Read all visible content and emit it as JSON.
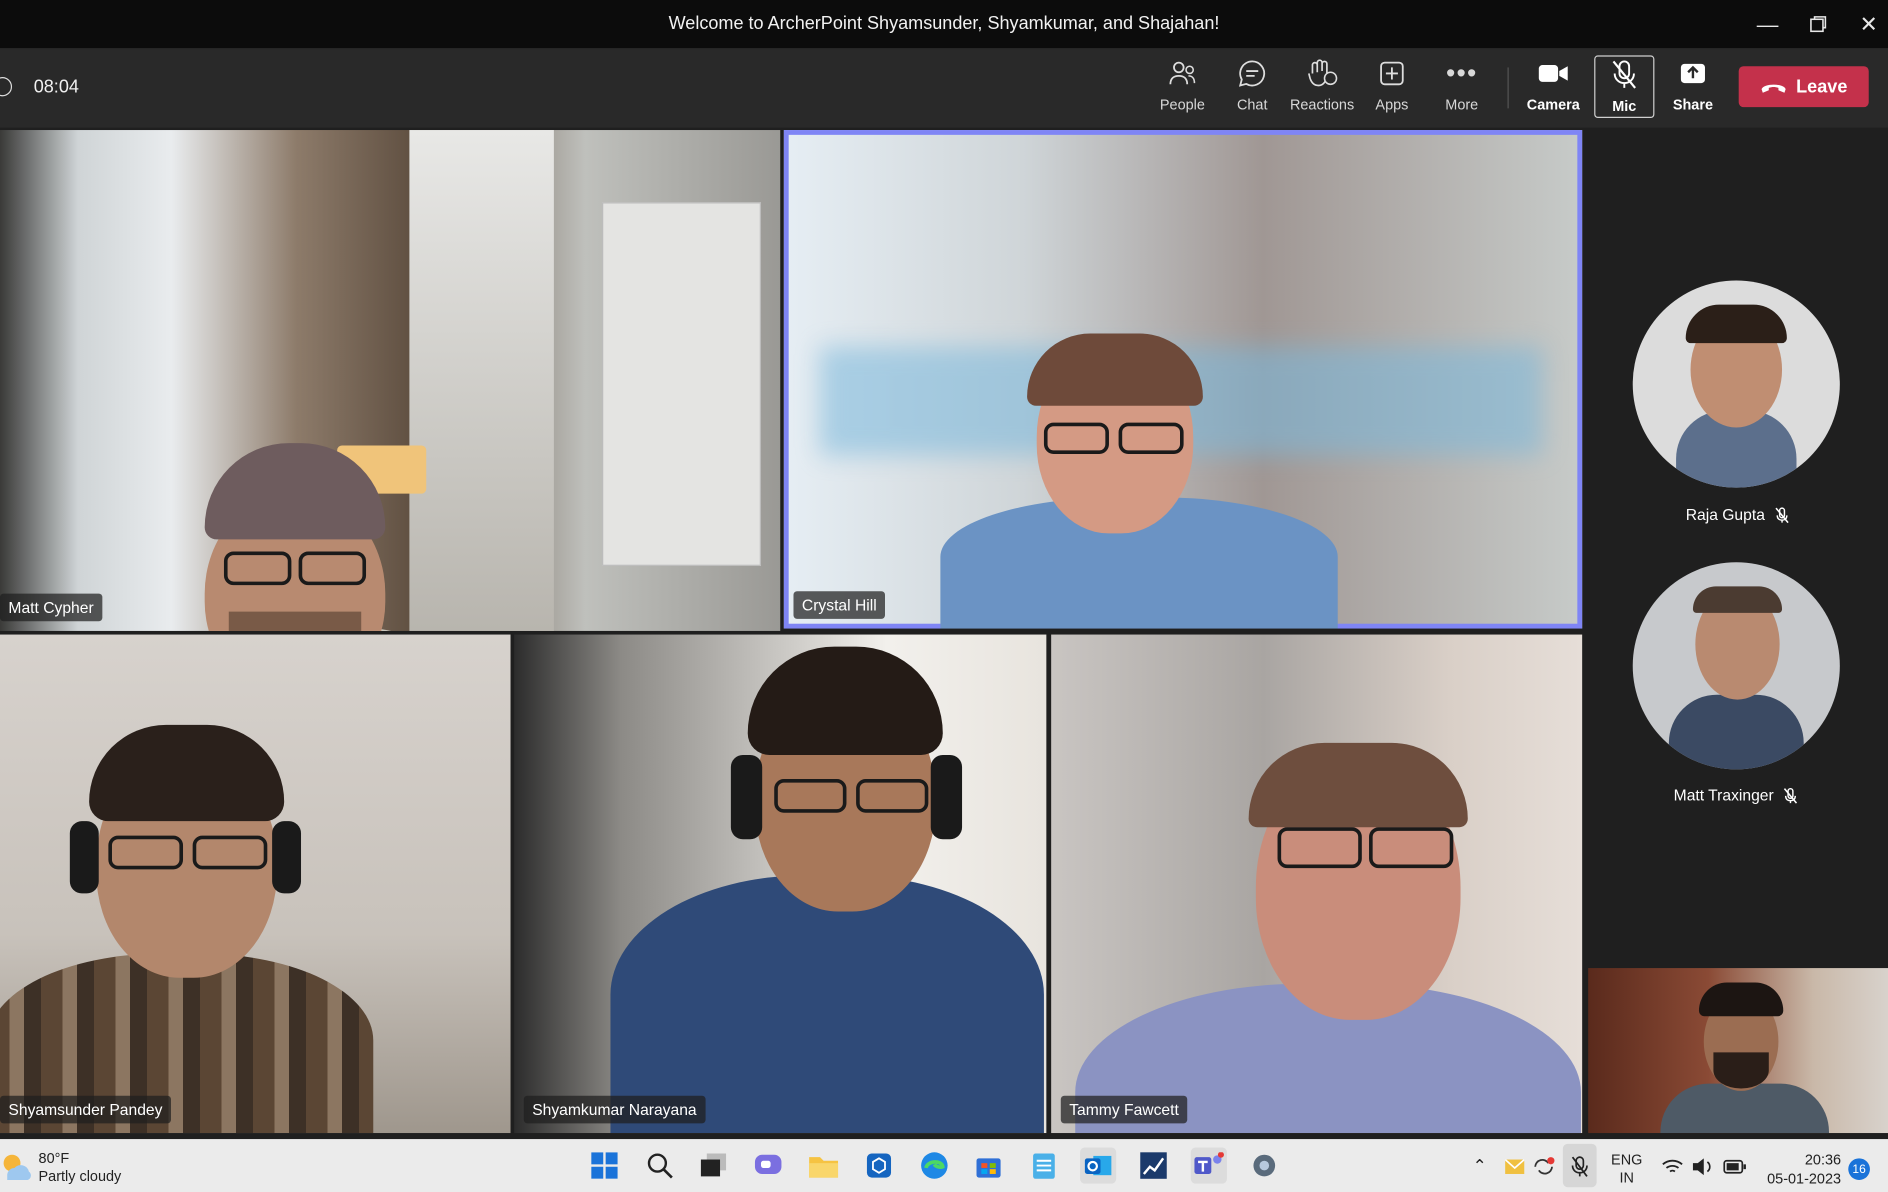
{
  "window": {
    "title": "Welcome to ArcherPoint Shyamsunder, Shyamkumar, and Shajahan!"
  },
  "toolbar": {
    "timer": "08:04",
    "buttons": [
      {
        "label": "People",
        "icon": "people-icon"
      },
      {
        "label": "Chat",
        "icon": "chat-icon"
      },
      {
        "label": "Reactions",
        "icon": "reactions-icon"
      },
      {
        "label": "Apps",
        "icon": "apps-icon"
      },
      {
        "label": "More",
        "icon": "more-icon"
      },
      {
        "label": "Camera",
        "icon": "camera-icon"
      },
      {
        "label": "Mic",
        "icon": "mic-muted-icon"
      },
      {
        "label": "Share",
        "icon": "share-icon"
      }
    ],
    "leave_label": "Leave"
  },
  "participants": {
    "matt_cypher": "Matt Cypher",
    "crystal_hill": "Crystal Hill",
    "shyamsunder": "Shyamsunder Pandey",
    "shyamkumar": "Shyamkumar Narayana",
    "tammy": "Tammy Fawcett",
    "raja": "Raja Gupta",
    "matt_traxinger": "Matt Traxinger"
  },
  "taskbar": {
    "weather_temp": "80°F",
    "weather_desc": "Partly cloudy",
    "lang_top": "ENG",
    "lang_bottom": "IN",
    "time": "20:36",
    "date": "05-01-2023",
    "notification_count": "16"
  },
  "colors": {
    "speaker_border": "#7f85f5",
    "leave": "#c4314b",
    "teams_bg": "#1f1f1f"
  }
}
